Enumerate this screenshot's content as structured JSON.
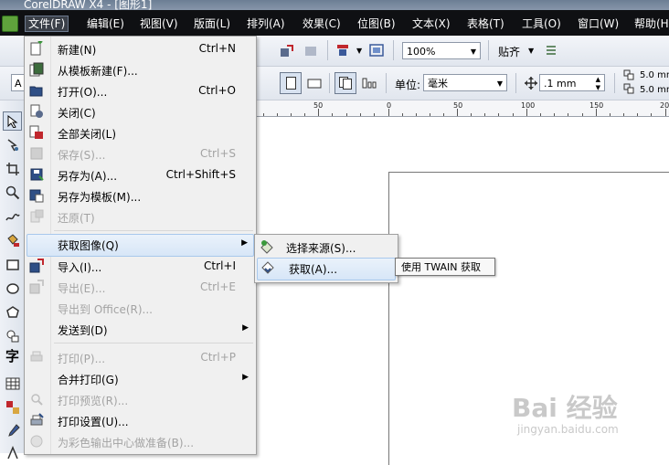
{
  "window": {
    "title": "CorelDRAW X4 - [图形1]"
  },
  "menubar": {
    "items": [
      {
        "label": "文件(F)",
        "active": true
      },
      {
        "label": "编辑(E)"
      },
      {
        "label": "视图(V)"
      },
      {
        "label": "版面(L)"
      },
      {
        "label": "排列(A)"
      },
      {
        "label": "效果(C)"
      },
      {
        "label": "位图(B)"
      },
      {
        "label": "文本(X)"
      },
      {
        "label": "表格(T)"
      },
      {
        "label": "工具(O)"
      },
      {
        "label": "窗口(W)"
      },
      {
        "label": "帮助(H"
      }
    ]
  },
  "toolbar": {
    "zoom_value": "100%",
    "snap_label": "贴齐",
    "unit_label": "单位:",
    "unit_value": "毫米",
    "nudge_value": ".1 mm",
    "dup_x": "5.0 mm",
    "dup_y": "5.0 mm",
    "left_input": "A"
  },
  "ruler": {
    "labels": [
      "50",
      "0",
      "50",
      "100",
      "150",
      "20"
    ]
  },
  "file_menu": {
    "items": [
      {
        "label": "新建(N)",
        "shortcut": "Ctrl+N",
        "icon": "new-doc-icon"
      },
      {
        "label": "从模板新建(F)...",
        "shortcut": "",
        "icon": "template-icon"
      },
      {
        "label": "打开(O)...",
        "shortcut": "Ctrl+O",
        "icon": "open-folder-icon"
      },
      {
        "label": "关闭(C)",
        "shortcut": "",
        "icon": "close-doc-icon"
      },
      {
        "label": "全部关闭(L)",
        "shortcut": "",
        "icon": "close-all-icon"
      },
      {
        "label": "保存(S)...",
        "shortcut": "Ctrl+S",
        "icon": "save-icon",
        "disabled": true
      },
      {
        "label": "另存为(A)...",
        "shortcut": "Ctrl+Shift+S",
        "icon": "save-as-icon"
      },
      {
        "label": "另存为模板(M)...",
        "shortcut": "",
        "icon": "save-template-icon"
      },
      {
        "label": "还原(T)",
        "shortcut": "",
        "icon": "revert-icon",
        "disabled": true
      },
      {
        "label": "获取图像(Q)",
        "shortcut": "",
        "submenu": true,
        "highlighted": true
      },
      {
        "label": "导入(I)...",
        "shortcut": "Ctrl+I",
        "icon": "import-icon"
      },
      {
        "label": "导出(E)...",
        "shortcut": "Ctrl+E",
        "icon": "export-icon",
        "disabled": true
      },
      {
        "label": "导出到 Office(R)...",
        "shortcut": "",
        "disabled": true
      },
      {
        "label": "发送到(D)",
        "shortcut": "",
        "submenu": true
      },
      {
        "label": "打印(P)...",
        "shortcut": "Ctrl+P",
        "icon": "print-icon",
        "disabled": true
      },
      {
        "label": "合并打印(G)",
        "shortcut": "",
        "submenu": true
      },
      {
        "label": "打印预览(R)...",
        "shortcut": "",
        "icon": "print-preview-icon",
        "disabled": true
      },
      {
        "label": "打印设置(U)...",
        "shortcut": "",
        "icon": "print-setup-icon"
      },
      {
        "label": "为彩色输出中心做准备(B)...",
        "shortcut": "",
        "icon": "color-output-icon",
        "disabled": true
      }
    ]
  },
  "submenu": {
    "items": [
      {
        "label": "选择来源(S)...",
        "icon": "select-source-icon"
      },
      {
        "label": "获取(A)...",
        "icon": "acquire-icon",
        "highlighted": true
      }
    ]
  },
  "tooltip": {
    "text": "使用 TWAIN 获取"
  },
  "watermark": {
    "logo": "Bai 经验",
    "url": "jingyan.baidu.com"
  },
  "colors": {
    "menubar_bg": "#0f1013",
    "highlight_bg": "#d7e6f7",
    "highlight_border": "#a8c8ec"
  }
}
